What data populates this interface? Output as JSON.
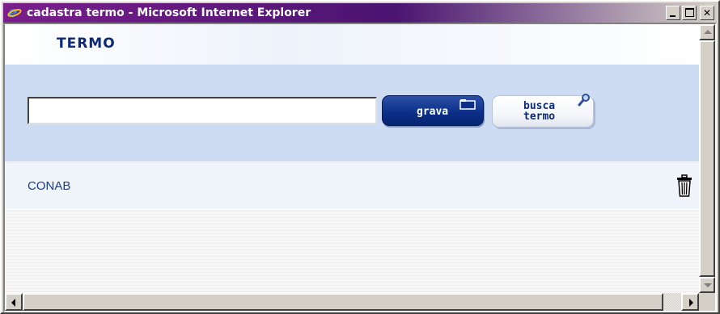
{
  "window": {
    "title": "cadastra termo - Microsoft Internet Explorer",
    "controls": {
      "minimize": "minimize",
      "maximize": "maximize",
      "close": "close"
    }
  },
  "page": {
    "heading": "TERMO",
    "form": {
      "term_input_value": "",
      "term_input_placeholder": "",
      "grava_label": "grava",
      "busca_label_line1": "busca",
      "busca_label_line2": "termo"
    },
    "results": [
      {
        "label": "CONAB",
        "action_icon": "trash-icon"
      }
    ]
  },
  "icons": {
    "app": "ie-icon",
    "grava": "folder-icon",
    "busca": "search-icon",
    "delete": "trash-icon"
  },
  "colors": {
    "titlebar": "#4a1470",
    "heading": "#0c2a78",
    "form_band": "#cddcf2",
    "grava_button": "#0b2f86",
    "result_text": "#1a3d8c"
  }
}
